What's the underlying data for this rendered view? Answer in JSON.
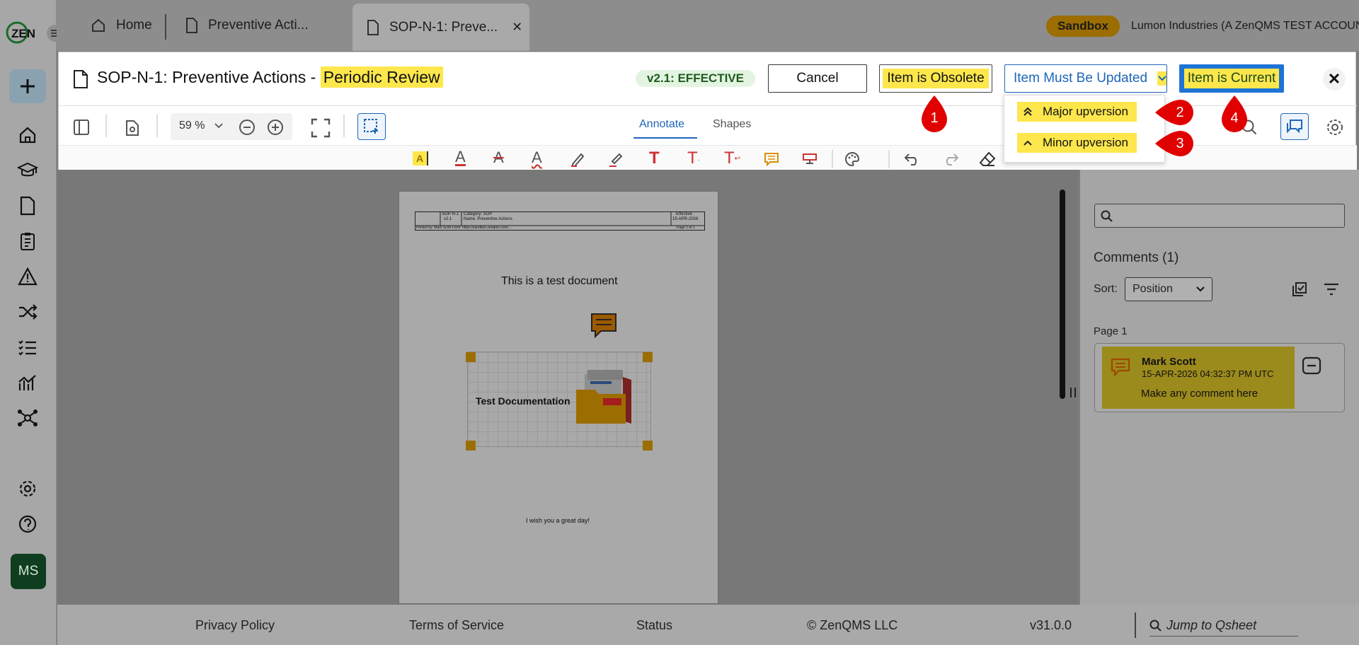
{
  "tabs": [
    {
      "label": "Home"
    },
    {
      "label": "Preventive Acti..."
    },
    {
      "label": "SOP-N-1: Preve..."
    }
  ],
  "header": {
    "sandbox": "Sandbox",
    "org": "Lumon Industries (A ZenQMS TEST ACCOUNT)"
  },
  "modal": {
    "title_prefix": "SOP-N-1: Preventive Actions - ",
    "title_highlight": "Periodic Review",
    "status": "v2.1: EFFECTIVE",
    "cancel": "Cancel",
    "obsolete": "Item is Obsolete",
    "must_update": "Item Must Be Updated",
    "current": "Item is Current",
    "zoom": "59 %",
    "tab_annotate": "Annotate",
    "tab_shapes": "Shapes"
  },
  "dropdown": {
    "major": "Major upversion",
    "minor": "Minor upversion"
  },
  "markers": [
    "1",
    "2",
    "3",
    "4"
  ],
  "document": {
    "hdr_id": "SOP-N-1",
    "hdr_ver": "v2.1",
    "hdr_cat": "Category: SOP",
    "hdr_name": "Name: Preventive Actions",
    "hdr_eff": "Effective",
    "hdr_date": "15-APR-2026",
    "hdr_printed": "Printed by: Mark Scott  From: https://sandbox.zenqms.com/...",
    "hdr_page": "Page 1 of 1",
    "heading": "This is a test document",
    "image_label": "Test Documentation",
    "closing": "I wish you a great day!"
  },
  "comments": {
    "title": "Comments (1)",
    "sort_label": "Sort:",
    "sort_value": "Position",
    "page": "Page 1",
    "author": "Mark Scott",
    "timestamp": "15-APR-2026 04:32:37 PM UTC",
    "text": "Make any comment here"
  },
  "footer": {
    "privacy": "Privacy Policy",
    "terms": "Terms of Service",
    "status": "Status",
    "copyright": "© ZenQMS LLC",
    "version": "v31.0.0",
    "jump": "Jump to Qsheet"
  },
  "logo": "ZEN",
  "avatar": "MS",
  "colors": {
    "highlight": "#fde74c",
    "primary": "#1d74d6",
    "marker": "#e00000",
    "status_bg": "#e3f4e1"
  }
}
